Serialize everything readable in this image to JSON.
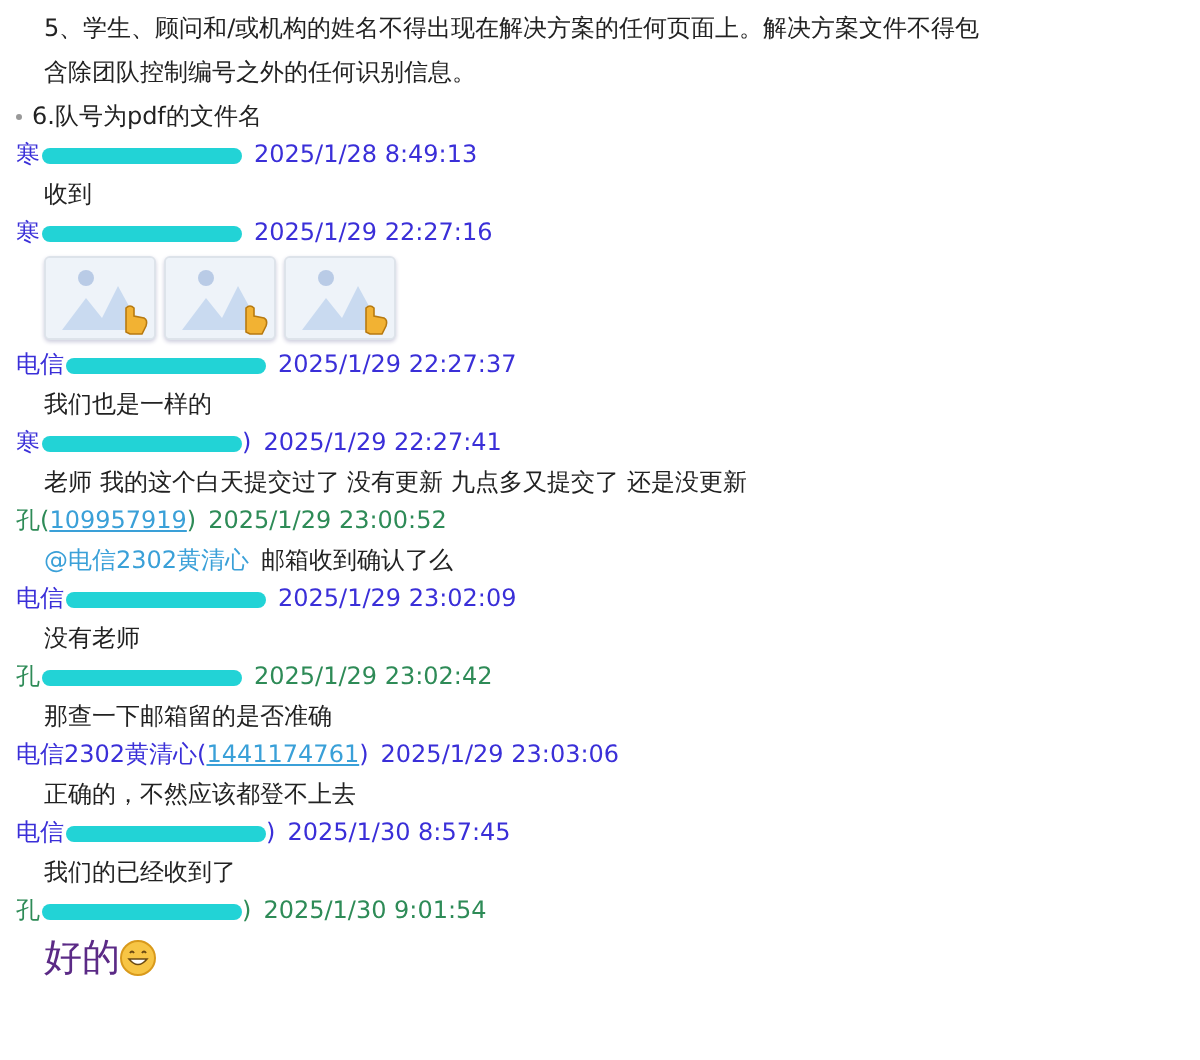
{
  "intro": {
    "text": "5、学生、顾问和/或机构的姓名不得出现在解决方案的任何页面上。解决方案文件不得包含除团队控制编号之外的任何识别信息。",
    "bullet": "6.队号为pdf的文件名"
  },
  "messages": [
    {
      "header": {
        "name": "寒",
        "redacted": true,
        "time": "2025/1/28 8:49:13",
        "color": "#3a2fd8"
      },
      "kind": "text",
      "text": "收到"
    },
    {
      "header": {
        "name": "寒",
        "redacted": true,
        "time": "2025/1/29 22:27:16",
        "color": "#3a2fd8"
      },
      "kind": "images"
    },
    {
      "header": {
        "name": "电信",
        "redacted": true,
        "time": "2025/1/29 22:27:37",
        "color": "#3a2fd8"
      },
      "kind": "text",
      "text": "我们也是一样的"
    },
    {
      "header": {
        "name": "寒",
        "redacted": true,
        "tail": ")",
        "time": "2025/1/29 22:27:41",
        "color": "#3a2fd8"
      },
      "kind": "text",
      "text": "老师  我的这个白天提交过了 没有更新  九点多又提交了  还是没更新"
    },
    {
      "header": {
        "name": "孔",
        "open": "(",
        "qq": "109957919",
        "close": ")",
        "time": "2025/1/29 23:00:52",
        "color": "#2e8b57"
      },
      "kind": "mention",
      "mention": "@电信2302黄清心",
      "text": "邮箱收到确认了么"
    },
    {
      "header": {
        "name": "电信",
        "redacted": true,
        "time": "2025/1/29 23:02:09",
        "color": "#3a2fd8"
      },
      "kind": "text",
      "text": "没有老师"
    },
    {
      "header": {
        "name": "孔",
        "redacted": true,
        "time": "2025/1/29 23:02:42",
        "color": "#2e8b57"
      },
      "kind": "text",
      "text": "那查一下邮箱留的是否准确"
    },
    {
      "header": {
        "name": "电信2302黄清心",
        "open": "(",
        "qq": "1441174761",
        "close": ")",
        "time": "2025/1/29 23:03:06",
        "color": "#3a2fd8"
      },
      "kind": "text",
      "text": "正确的，不然应该都登不上去"
    },
    {
      "header": {
        "name": "电信",
        "redacted": true,
        "tail": ")",
        "time": "2025/1/30 8:57:45",
        "color": "#3a2fd8"
      },
      "kind": "text",
      "text": "我们的已经收到了"
    },
    {
      "header": {
        "name": "孔",
        "redacted": true,
        "tail": ")",
        "time": "2025/1/30 9:01:54",
        "color": "#2e8b57"
      },
      "kind": "big",
      "text": "好的",
      "emoji": true
    }
  ]
}
